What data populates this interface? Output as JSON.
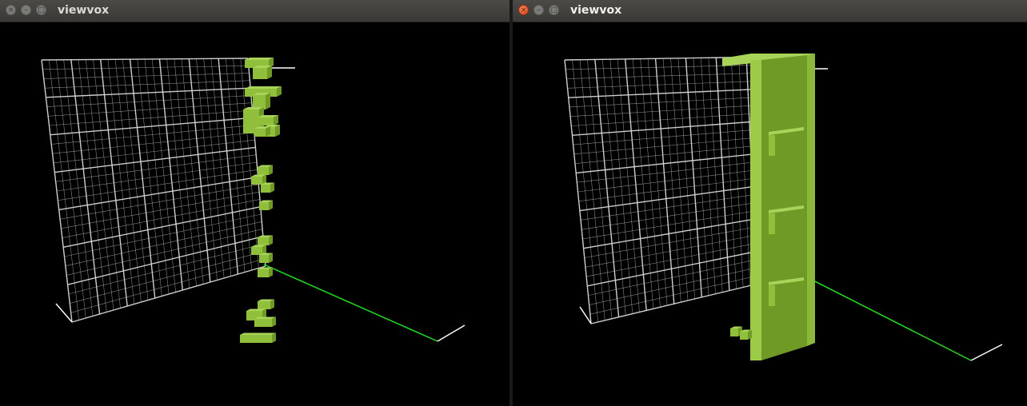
{
  "windows": [
    {
      "title": "viewvox",
      "active": false,
      "buttons": {
        "close": "×",
        "minimize": "–",
        "maximize": "□"
      }
    },
    {
      "title": "viewvox",
      "active": true,
      "buttons": {
        "close": "×",
        "minimize": "–",
        "maximize": "□"
      }
    }
  ],
  "colors": {
    "grid": "#d8d8d8",
    "voxel_top": "#a9d45a",
    "voxel_front": "#8fbf3b",
    "voxel_side": "#6f9a26",
    "axis_x": "#22dd22",
    "axis_marker": "#ffffff",
    "background": "#000000"
  },
  "icons": {
    "close": "close-icon",
    "minimize": "minimize-icon",
    "maximize": "maximize-icon"
  }
}
